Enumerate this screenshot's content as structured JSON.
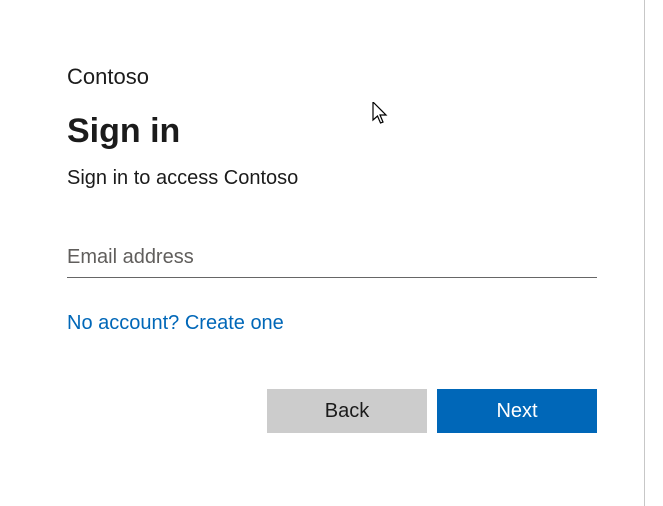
{
  "company_name": "Contoso",
  "title": "Sign in",
  "subtitle": "Sign in to access Contoso",
  "email_input": {
    "value": "",
    "placeholder": "Email address"
  },
  "create_account_link": "No account? Create one",
  "buttons": {
    "back": "Back",
    "next": "Next"
  }
}
